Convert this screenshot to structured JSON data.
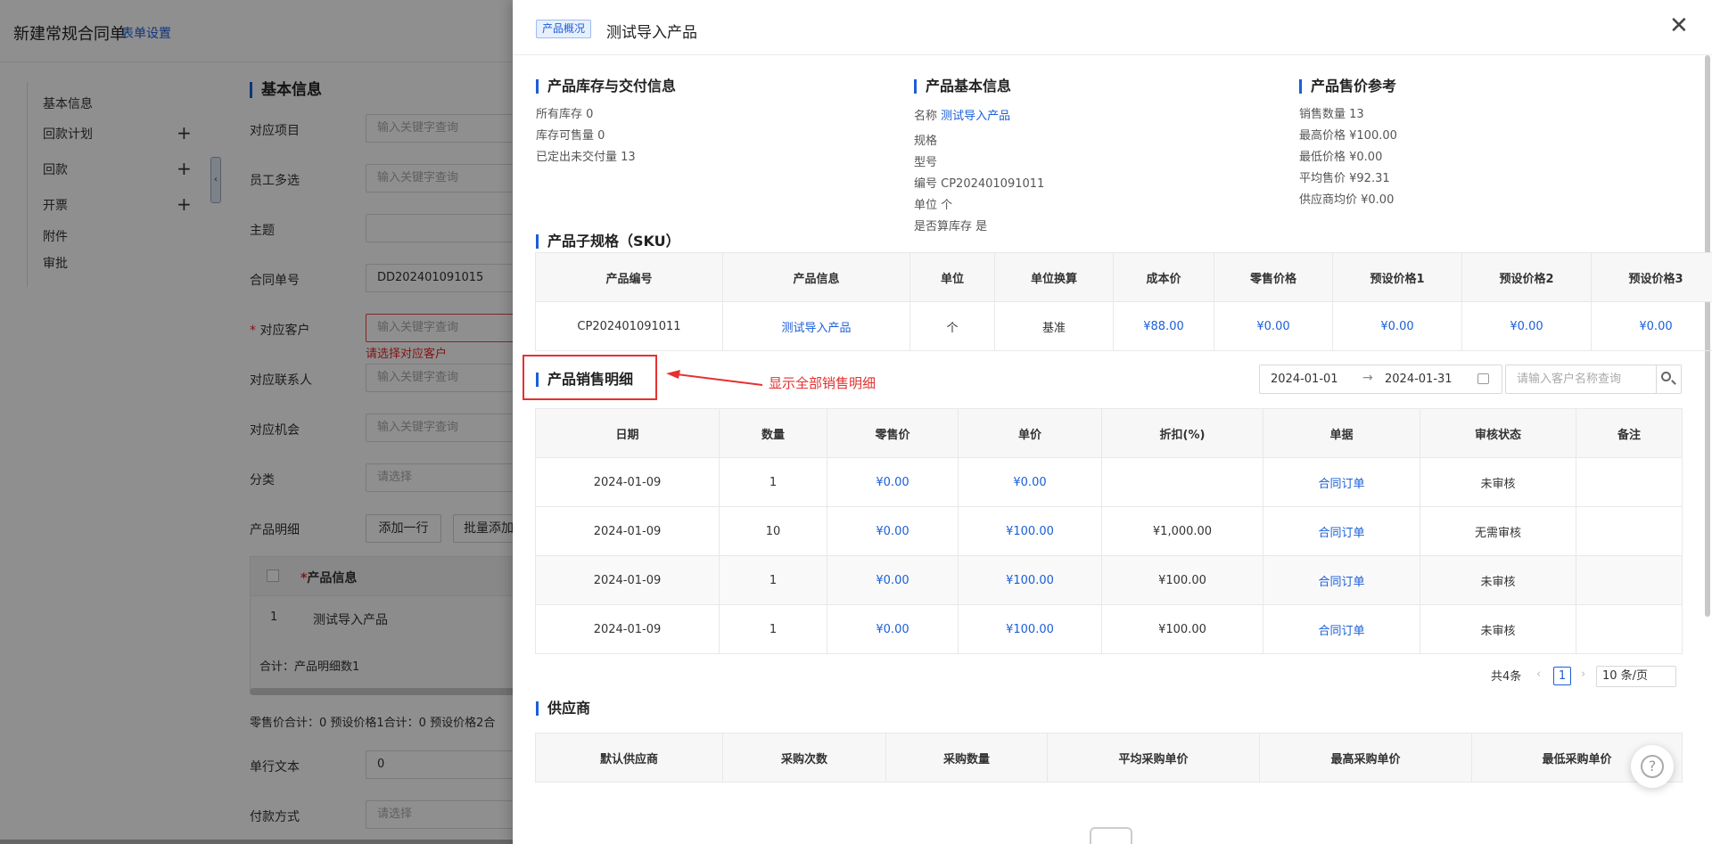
{
  "background_form": {
    "title": "新建常规合同单",
    "settings_link": "表单设置",
    "sidebar": [
      {
        "label": "基本信息",
        "plus": ""
      },
      {
        "label": "回款计划",
        "plus": "+"
      },
      {
        "label": "回款",
        "plus": "+"
      },
      {
        "label": "开票",
        "plus": "+"
      },
      {
        "label": "附件",
        "plus": ""
      },
      {
        "label": "审批",
        "plus": ""
      }
    ],
    "section_title": "基本信息",
    "fields": [
      {
        "label": "对应项目",
        "value": "输入关键字查询"
      },
      {
        "label": "员工多选",
        "value": "输入关键字查询"
      },
      {
        "label": "主题",
        "value": ""
      },
      {
        "label": "合同单号",
        "value": "DD202401091015"
      },
      {
        "label": "对应客户",
        "value": "输入关键字查询"
      },
      {
        "label": "对应联系人",
        "value": "输入关键字查询"
      },
      {
        "label": "对应机会",
        "value": "输入关键字查询"
      },
      {
        "label": "分类",
        "value": "请选择"
      },
      {
        "label": "产品明细",
        "value": ""
      },
      {
        "label": "单行文本",
        "value": "0"
      },
      {
        "label": "付款方式",
        "value": "请选择"
      }
    ],
    "required_mark": "*",
    "customer_error": "请选择对应客户",
    "add_row_button": "添加一行",
    "batch_add_button": "批量添加",
    "product_table_header": "产品信息",
    "product_row_index": "1",
    "product_row_name": "测试导入产品",
    "product_total": "合计：产品明细数1",
    "price_sums": "零售价合计：0  预设价格1合计：0  预设价格2合"
  },
  "drawer": {
    "tag": "产品概况",
    "title": "测试导入产品",
    "close": "✕",
    "inventory": {
      "title": "产品库存与交付信息",
      "rows": [
        "所有库存  0",
        "库存可售量  0",
        "已定出未交付量  13"
      ]
    },
    "basic": {
      "title": "产品基本信息",
      "name_label": "名称 ",
      "name_value": "测试导入产品",
      "rows": [
        "规格",
        "型号",
        "编号 CP202401091011",
        "单位 个",
        "是否算库存 是"
      ]
    },
    "price_ref": {
      "title": "产品售价参考",
      "rows": [
        "销售数量 13",
        "最高价格 ¥100.00",
        "最低价格 ¥0.00",
        "平均售价 ¥92.31",
        "供应商均价 ¥0.00"
      ]
    },
    "sku": {
      "title": "产品子规格（SKU）",
      "headers": [
        "产品编号",
        "产品信息",
        "单位",
        "单位换算",
        "成本价",
        "零售价格",
        "预设价格1",
        "预设价格2",
        "预设价格3"
      ],
      "row": [
        "CP202401091011",
        "测试导入产品",
        "个",
        "基准",
        "¥88.00",
        "¥0.00",
        "¥0.00",
        "¥0.00",
        "¥0.00"
      ]
    },
    "sales": {
      "title": "产品销售明细",
      "annotation": "显示全部销售明细",
      "date_start": "2024-01-01",
      "date_arrow": "→",
      "date_end": "2024-01-31",
      "customer_placeholder": "请输入客户名称查询",
      "headers": [
        "日期",
        "数量",
        "零售价",
        "单价",
        "折扣(%)",
        "单据",
        "审核状态",
        "备注"
      ],
      "rows": [
        [
          "2024-01-09",
          "1",
          "¥0.00",
          "¥0.00",
          "",
          "合同订单",
          "未审核",
          ""
        ],
        [
          "2024-01-09",
          "10",
          "¥0.00",
          "¥100.00",
          "¥1,000.00",
          "合同订单",
          "无需审核",
          ""
        ],
        [
          "2024-01-09",
          "1",
          "¥0.00",
          "¥100.00",
          "¥100.00",
          "合同订单",
          "未审核",
          ""
        ],
        [
          "2024-01-09",
          "1",
          "¥0.00",
          "¥100.00",
          "¥100.00",
          "合同订单",
          "未审核",
          ""
        ]
      ],
      "total": "共4条",
      "page": "1",
      "page_size": "10 条/页"
    },
    "supplier": {
      "title": "供应商",
      "headers": [
        "默认供应商",
        "采购次数",
        "采购数量",
        "平均采购单价",
        "最高采购单价",
        "最低采购单价"
      ]
    },
    "help": "?"
  },
  "colors": {
    "accent": "#1a5fd8",
    "error": "#e63030"
  }
}
